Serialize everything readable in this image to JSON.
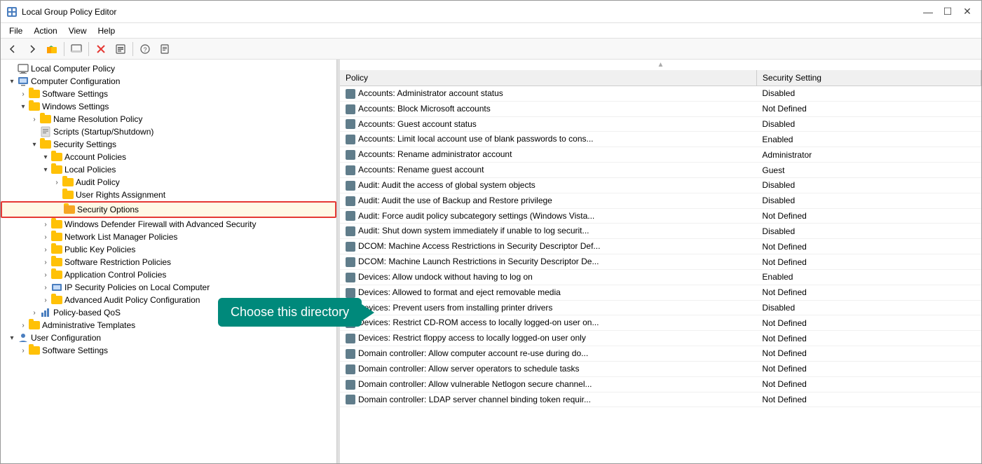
{
  "window": {
    "title": "Local Group Policy Editor",
    "controls": {
      "minimize": "—",
      "maximize": "☐",
      "close": "✕"
    }
  },
  "menu": {
    "items": [
      "File",
      "Action",
      "View",
      "Help"
    ]
  },
  "toolbar": {
    "buttons": [
      {
        "name": "back",
        "icon": "←"
      },
      {
        "name": "forward",
        "icon": "→"
      },
      {
        "name": "up",
        "icon": "📁"
      },
      {
        "name": "show-hide",
        "icon": "🖥"
      },
      {
        "name": "delete",
        "icon": "✕"
      },
      {
        "name": "properties",
        "icon": "📋"
      },
      {
        "name": "help",
        "icon": "?"
      },
      {
        "name": "export",
        "icon": "📄"
      }
    ]
  },
  "tree": {
    "root": "Local Computer Policy",
    "items": [
      {
        "id": "computer-config",
        "label": "Computer Configuration",
        "indent": 1,
        "expanded": true,
        "hasChildren": true
      },
      {
        "id": "software-settings",
        "label": "Software Settings",
        "indent": 2,
        "expanded": false,
        "hasChildren": true
      },
      {
        "id": "windows-settings",
        "label": "Windows Settings",
        "indent": 2,
        "expanded": true,
        "hasChildren": true
      },
      {
        "id": "name-resolution",
        "label": "Name Resolution Policy",
        "indent": 3,
        "expanded": false,
        "hasChildren": true
      },
      {
        "id": "scripts",
        "label": "Scripts (Startup/Shutdown)",
        "indent": 3,
        "expanded": false,
        "hasChildren": false
      },
      {
        "id": "security-settings",
        "label": "Security Settings",
        "indent": 3,
        "expanded": true,
        "hasChildren": true
      },
      {
        "id": "account-policies",
        "label": "Account Policies",
        "indent": 4,
        "expanded": false,
        "hasChildren": true
      },
      {
        "id": "local-policies",
        "label": "Local Policies",
        "indent": 4,
        "expanded": true,
        "hasChildren": true
      },
      {
        "id": "audit-policy",
        "label": "Audit Policy",
        "indent": 5,
        "expanded": false,
        "hasChildren": false
      },
      {
        "id": "user-rights",
        "label": "User Rights Assignment",
        "indent": 5,
        "expanded": false,
        "hasChildren": false
      },
      {
        "id": "security-options",
        "label": "Security Options",
        "indent": 5,
        "expanded": false,
        "hasChildren": false,
        "highlighted": true
      },
      {
        "id": "windows-firewall",
        "label": "Windows Defender Firewall with Advanced Security",
        "indent": 4,
        "expanded": false,
        "hasChildren": true
      },
      {
        "id": "network-list",
        "label": "Network List Manager Policies",
        "indent": 4,
        "expanded": false,
        "hasChildren": true
      },
      {
        "id": "public-key",
        "label": "Public Key Policies",
        "indent": 4,
        "expanded": false,
        "hasChildren": true
      },
      {
        "id": "software-restriction",
        "label": "Software Restriction Policies",
        "indent": 4,
        "expanded": false,
        "hasChildren": true
      },
      {
        "id": "app-control",
        "label": "Application Control Policies",
        "indent": 4,
        "expanded": false,
        "hasChildren": true
      },
      {
        "id": "ip-security",
        "label": "IP Security Policies on Local Computer",
        "indent": 4,
        "expanded": false,
        "hasChildren": true
      },
      {
        "id": "advanced-audit",
        "label": "Advanced Audit Policy Configuration",
        "indent": 4,
        "expanded": false,
        "hasChildren": true
      },
      {
        "id": "policy-qos",
        "label": "Policy-based QoS",
        "indent": 3,
        "expanded": false,
        "hasChildren": true
      },
      {
        "id": "admin-templates",
        "label": "Administrative Templates",
        "indent": 2,
        "expanded": false,
        "hasChildren": true
      },
      {
        "id": "user-config",
        "label": "User Configuration",
        "indent": 1,
        "expanded": true,
        "hasChildren": true
      },
      {
        "id": "user-software",
        "label": "Software Settings",
        "indent": 2,
        "expanded": false,
        "hasChildren": true
      }
    ]
  },
  "callout": {
    "text": "Choose this directory"
  },
  "table": {
    "columns": [
      "Policy",
      "Security Setting"
    ],
    "rows": [
      {
        "policy": "Accounts: Administrator account status",
        "setting": "Disabled"
      },
      {
        "policy": "Accounts: Block Microsoft accounts",
        "setting": "Not Defined"
      },
      {
        "policy": "Accounts: Guest account status",
        "setting": "Disabled"
      },
      {
        "policy": "Accounts: Limit local account use of blank passwords to cons...",
        "setting": "Enabled"
      },
      {
        "policy": "Accounts: Rename administrator account",
        "setting": "Administrator"
      },
      {
        "policy": "Accounts: Rename guest account",
        "setting": "Guest"
      },
      {
        "policy": "Audit: Audit the access of global system objects",
        "setting": "Disabled"
      },
      {
        "policy": "Audit: Audit the use of Backup and Restore privilege",
        "setting": "Disabled"
      },
      {
        "policy": "Audit: Force audit policy subcategory settings (Windows Vista...",
        "setting": "Not Defined"
      },
      {
        "policy": "Audit: Shut down system immediately if unable to log securit...",
        "setting": "Disabled"
      },
      {
        "policy": "DCOM: Machine Access Restrictions in Security Descriptor Def...",
        "setting": "Not Defined"
      },
      {
        "policy": "DCOM: Machine Launch Restrictions in Security Descriptor De...",
        "setting": "Not Defined"
      },
      {
        "policy": "Devices: Allow undock without having to log on",
        "setting": "Enabled"
      },
      {
        "policy": "Devices: Allowed to format and eject removable media",
        "setting": "Not Defined"
      },
      {
        "policy": "Devices: Prevent users from installing printer drivers",
        "setting": "Disabled"
      },
      {
        "policy": "Devices: Restrict CD-ROM access to locally logged-on user on...",
        "setting": "Not Defined"
      },
      {
        "policy": "Devices: Restrict floppy access to locally logged-on user only",
        "setting": "Not Defined"
      },
      {
        "policy": "Domain controller: Allow computer account re-use during do...",
        "setting": "Not Defined"
      },
      {
        "policy": "Domain controller: Allow server operators to schedule tasks",
        "setting": "Not Defined"
      },
      {
        "policy": "Domain controller: Allow vulnerable Netlogon secure channel...",
        "setting": "Not Defined"
      },
      {
        "policy": "Domain controller: LDAP server channel binding token requir...",
        "setting": "Not Defined"
      }
    ]
  }
}
